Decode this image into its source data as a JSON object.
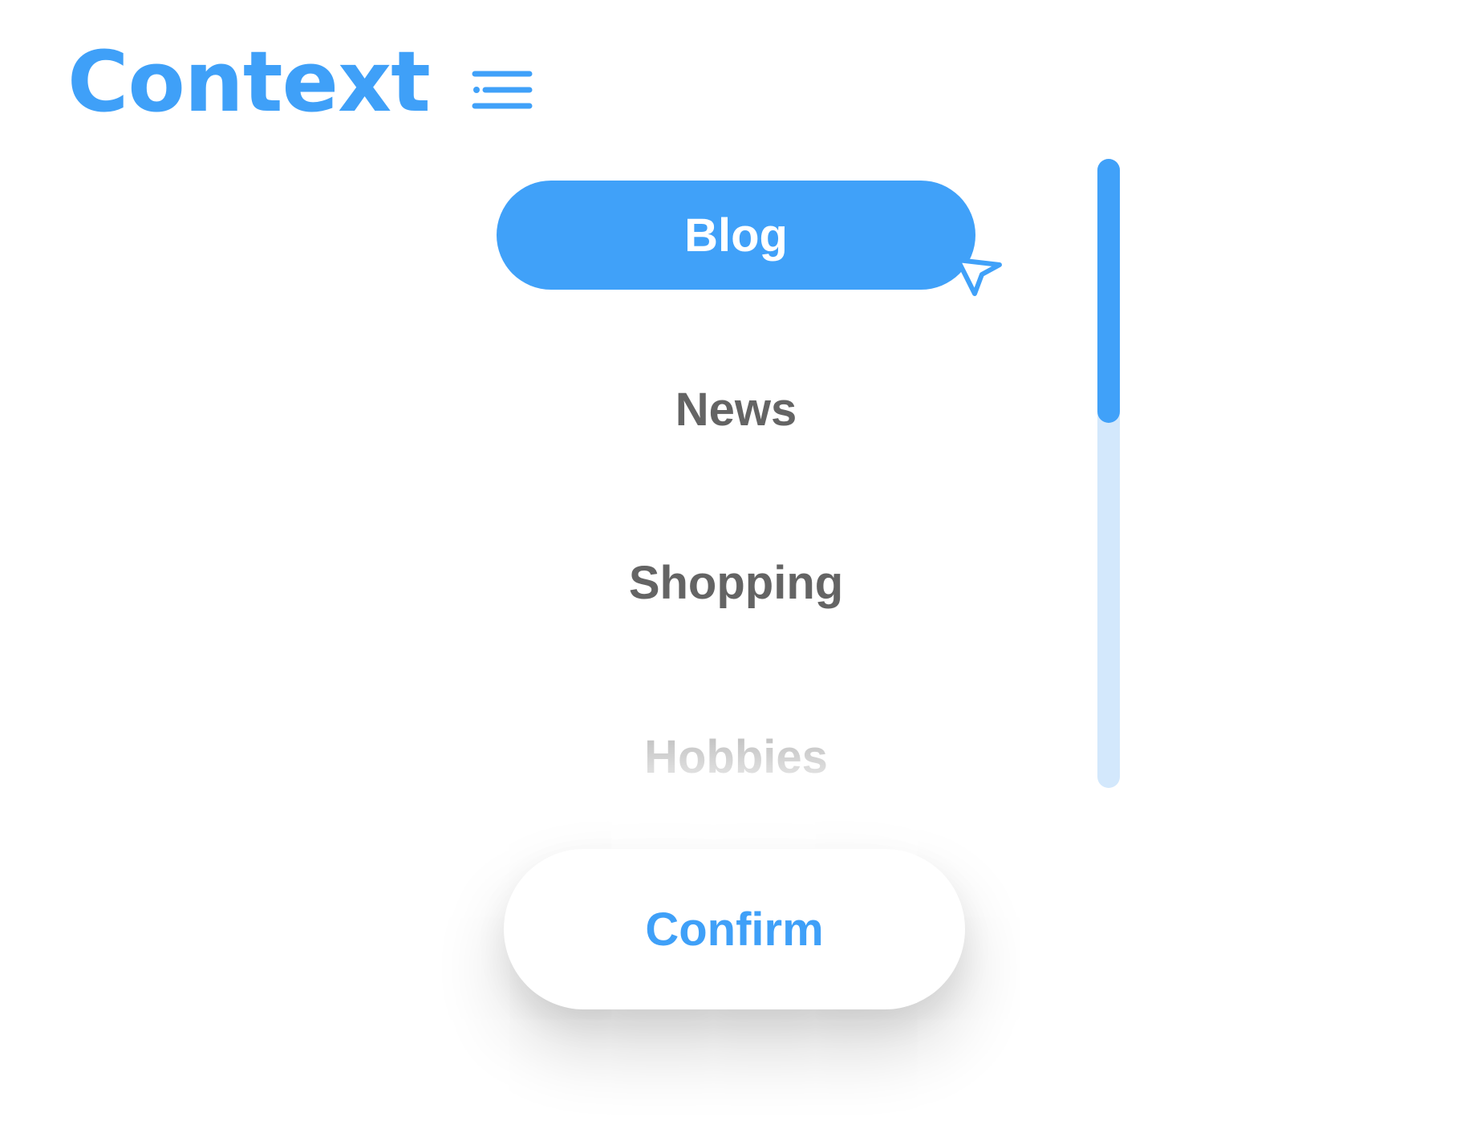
{
  "header": {
    "brand": "Context",
    "menu_icon": "menu-lines-icon"
  },
  "menu": {
    "items": [
      {
        "label": "Blog",
        "state": "selected"
      },
      {
        "label": "News",
        "state": "normal"
      },
      {
        "label": "Shopping",
        "state": "normal"
      },
      {
        "label": "Hobbies",
        "state": "faded"
      }
    ],
    "cursor_icon": "pointer-arrow-icon"
  },
  "scrollbar": {
    "position_fraction": 0,
    "visible_fraction": 0.42
  },
  "footer": {
    "confirm_label": "Confirm"
  },
  "colors": {
    "accent": "#40a1f9",
    "track": "#d3e8fc",
    "text": "#646464",
    "background": "#ffffff"
  }
}
